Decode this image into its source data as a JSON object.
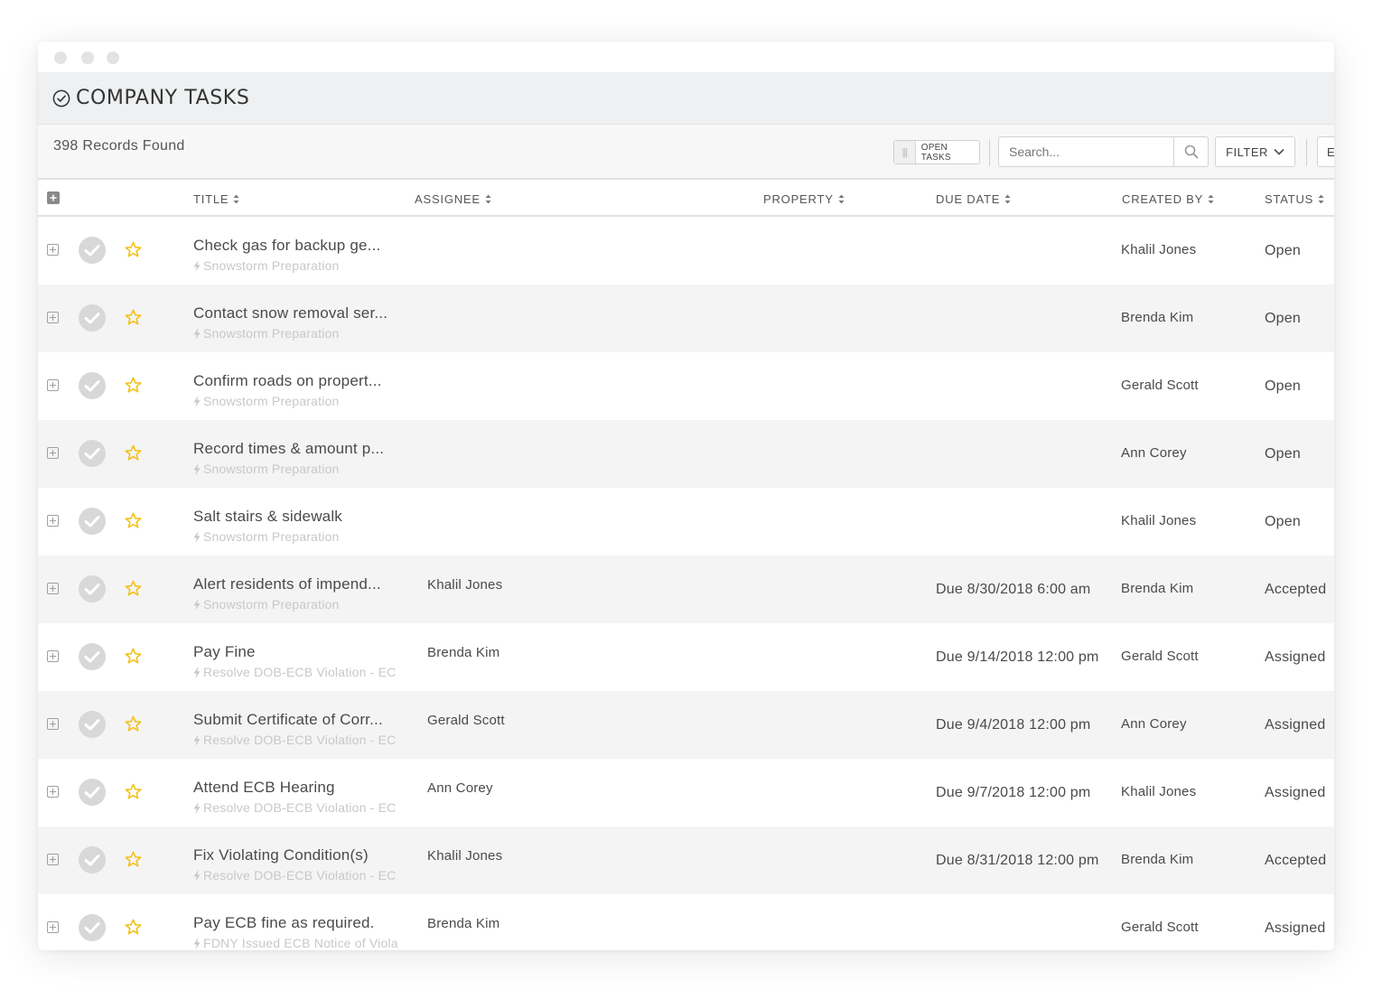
{
  "window": {
    "title": "COMPANY TASKS"
  },
  "toolbar": {
    "records_found": "398 Records Found",
    "toggle_label": "OPEN TASKS",
    "search_placeholder": "Search...",
    "filter_label": "FILTER",
    "extra_label": "E"
  },
  "columns": {
    "title": "TITLE",
    "assignee": "ASSIGNEE",
    "property": "PROPERTY",
    "due_date": "DUE DATE",
    "created_by": "CREATED BY",
    "status": "STATUS"
  },
  "icons": {
    "window_title": "check-circle-icon",
    "search": "search-icon",
    "filter": "chevron-down-icon",
    "expand": "plus-square-icon",
    "complete": "check-circle-icon",
    "favorite": "star-icon",
    "group": "bolt-icon",
    "sort": "sort-icon"
  },
  "colors": {
    "star": "#f2c21b",
    "complete_circle": "#d8d8d8",
    "header_bg": "#eef0f2",
    "row_alt_bg": "#f4f4f4",
    "group_text": "#c8c8c8"
  },
  "rows": [
    {
      "title": "Check gas for backup ge...",
      "group": "Snowstorm Preparation",
      "assignee": "",
      "property": "",
      "due": "",
      "created_by": "Khalil Jones",
      "status": "Open"
    },
    {
      "title": "Contact snow removal ser...",
      "group": "Snowstorm Preparation",
      "assignee": "",
      "property": "",
      "due": "",
      "created_by": "Brenda Kim",
      "status": "Open"
    },
    {
      "title": "Confirm roads on propert...",
      "group": "Snowstorm Preparation",
      "assignee": "",
      "property": "",
      "due": "",
      "created_by": "Gerald Scott",
      "status": "Open"
    },
    {
      "title": "Record times & amount p...",
      "group": "Snowstorm Preparation",
      "assignee": "",
      "property": "",
      "due": "",
      "created_by": "Ann Corey",
      "status": "Open"
    },
    {
      "title": "Salt stairs & sidewalk",
      "group": "Snowstorm Preparation",
      "assignee": "",
      "property": "",
      "due": "",
      "created_by": "Khalil Jones",
      "status": "Open"
    },
    {
      "title": "Alert residents of impend...",
      "group": "Snowstorm Preparation",
      "assignee": "Khalil Jones",
      "property": "",
      "due": "Due 8/30/2018 6:00 am",
      "created_by": "Brenda Kim",
      "status": "Accepted"
    },
    {
      "title": "Pay Fine",
      "group": "Resolve DOB-ECB Violation - EC",
      "assignee": "Brenda Kim",
      "property": "",
      "due": "Due 9/14/2018 12:00 pm",
      "created_by": "Gerald Scott",
      "status": "Assigned"
    },
    {
      "title": "Submit Certificate of Corr...",
      "group": "Resolve DOB-ECB Violation - EC",
      "assignee": "Gerald Scott",
      "property": "",
      "due": "Due 9/4/2018 12:00 pm",
      "created_by": "Ann Corey",
      "status": "Assigned"
    },
    {
      "title": "Attend ECB Hearing",
      "group": "Resolve DOB-ECB Violation - EC",
      "assignee": "Ann Corey",
      "property": "",
      "due": "Due 9/7/2018 12:00 pm",
      "created_by": "Khalil Jones",
      "status": "Assigned"
    },
    {
      "title": "Fix Violating Condition(s)",
      "group": "Resolve DOB-ECB Violation - EC",
      "assignee": "Khalil Jones",
      "property": "",
      "due": "Due 8/31/2018 12:00 pm",
      "created_by": "Brenda Kim",
      "status": "Accepted"
    },
    {
      "title": "Pay ECB fine as required.",
      "group": "FDNY Issued ECB Notice of Viola",
      "assignee": "Brenda Kim",
      "property": "",
      "due": "",
      "created_by": "Gerald Scott",
      "status": "Assigned"
    }
  ]
}
